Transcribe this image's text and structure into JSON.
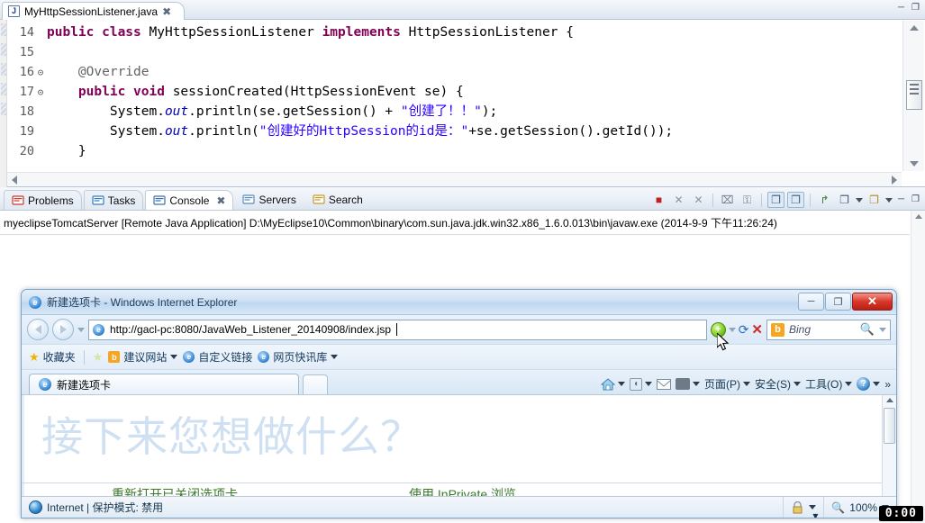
{
  "eclipse": {
    "editor_tab": {
      "label": "MyHttpSessionListener.java",
      "icon": "java-file-icon",
      "close": "✖"
    },
    "window_controls": {
      "minimize": "─",
      "maximize": "❐"
    },
    "code_lines": [
      {
        "num": "14",
        "fold": "",
        "tokens": [
          {
            "t": "kw",
            "s": "public "
          },
          {
            "t": "kw",
            "s": "class "
          },
          {
            "t": "plain",
            "s": "MyHttpSessionListener "
          },
          {
            "t": "kw",
            "s": "implements "
          },
          {
            "t": "plain",
            "s": "HttpSessionListener {"
          }
        ]
      },
      {
        "num": "15",
        "fold": "",
        "tokens": []
      },
      {
        "num": "16",
        "fold": "⊝",
        "tokens": [
          {
            "t": "plain",
            "s": "    "
          },
          {
            "t": "ann",
            "s": "@Override"
          }
        ]
      },
      {
        "num": "17",
        "fold": "⊝",
        "tokens": [
          {
            "t": "plain",
            "s": "    "
          },
          {
            "t": "kw",
            "s": "public "
          },
          {
            "t": "kw",
            "s": "void "
          },
          {
            "t": "plain",
            "s": "sessionCreated(HttpSessionEvent se) {"
          }
        ]
      },
      {
        "num": "18",
        "fold": "",
        "tokens": [
          {
            "t": "plain",
            "s": "        System."
          },
          {
            "t": "fld",
            "s": "out"
          },
          {
            "t": "plain",
            "s": ".println(se.getSession() + "
          },
          {
            "t": "str",
            "s": "\"创建了！！\""
          },
          {
            "t": "plain",
            "s": ");"
          }
        ]
      },
      {
        "num": "19",
        "fold": "",
        "tokens": [
          {
            "t": "plain",
            "s": "        System."
          },
          {
            "t": "fld",
            "s": "out"
          },
          {
            "t": "plain",
            "s": ".println("
          },
          {
            "t": "str",
            "s": "\"创建好的HttpSession的id是：\""
          },
          {
            "t": "plain",
            "s": "+se.getSession().getId());"
          }
        ]
      },
      {
        "num": "20",
        "fold": "",
        "tokens": [
          {
            "t": "plain",
            "s": "    }"
          }
        ]
      }
    ]
  },
  "console_view": {
    "tabs": [
      {
        "label": "Problems",
        "icon": "problems-icon",
        "active": false,
        "closable": false
      },
      {
        "label": "Tasks",
        "icon": "tasks-icon",
        "active": false,
        "closable": false
      },
      {
        "label": "Console",
        "icon": "console-icon",
        "active": true,
        "closable": true
      },
      {
        "label": "Servers",
        "icon": "servers-icon",
        "active": false,
        "closable": false
      },
      {
        "label": "Search",
        "icon": "search-icon",
        "active": false,
        "closable": false
      }
    ],
    "close_glyph": "✖",
    "toolbar": [
      {
        "name": "terminate-button",
        "glyph": "■",
        "selected": false,
        "color": "#c02020"
      },
      {
        "name": "remove-launch-button",
        "glyph": "✕",
        "selected": false,
        "color": "#8a96a3"
      },
      {
        "name": "remove-all-terminated-button",
        "glyph": "✕",
        "selected": false,
        "color": "#8a96a3"
      },
      {
        "name": "clear-console-button",
        "glyph": "⌧",
        "selected": false,
        "color": "#6f7c8a"
      },
      {
        "name": "scroll-lock-button",
        "glyph": "⚿",
        "selected": false,
        "color": "#6f7c8a"
      },
      {
        "name": "show-console-on-output-button",
        "glyph": "❐",
        "selected": true,
        "color": "#3f5a78"
      },
      {
        "name": "show-console-on-error-button",
        "glyph": "❐",
        "selected": true,
        "color": "#3f5a78"
      },
      {
        "name": "pin-console-button",
        "glyph": "↱",
        "selected": false,
        "color": "#4a7a3a"
      },
      {
        "name": "display-selected-console-button",
        "glyph": "❐",
        "selected": false,
        "color": "#3f5a78"
      },
      {
        "name": "open-console-button",
        "glyph": "❐",
        "selected": false,
        "color": "#b08a2a"
      }
    ],
    "view_minimize": "─",
    "view_maximize": "❐",
    "output_line": "myeclipseTomcatServer [Remote Java Application] D:\\MyEclipse10\\Common\\binary\\com.sun.java.jdk.win32.x86_1.6.0.013\\bin\\javaw.exe (2014-9-9 下午11:26:24)"
  },
  "ie_window": {
    "title": "新建选项卡 - Windows Internet Explorer",
    "title_icon": "ie-logo-icon",
    "controls": {
      "minimize": "─",
      "restore": "❐",
      "close": "✕"
    },
    "back_button": "back-arrow",
    "forward_button": "forward-arrow",
    "history_caret": "▾",
    "address": {
      "icon": "page-icon",
      "value": "http://gacl-pc:8080/JavaWeb_Listener_20140908/index.jsp",
      "placeholder": "http://"
    },
    "addr_tools": {
      "compat_glyph": "+",
      "compat_caret": "▾",
      "refresh_glyph": "⟳",
      "stop_glyph": "✕"
    },
    "search": {
      "engine": "Bing",
      "placeholder": "Bing",
      "value": "",
      "caret": "▾"
    },
    "favorites_bar": {
      "favorites_label": "收藏夹",
      "add_to_favorites": "add-favorite-icon",
      "items": [
        {
          "label": "建议网站",
          "icon": "suggested-sites-icon",
          "caret": "▾"
        },
        {
          "label": "自定义链接",
          "icon": "ie-icon",
          "caret": ""
        },
        {
          "label": "网页快讯库",
          "icon": "ie-icon",
          "caret": "▾"
        }
      ]
    },
    "tab": {
      "label": "新建选项卡",
      "icon": "ie-logo-icon"
    },
    "new_tab_button": "new-tab-button",
    "command_bar": {
      "home": {
        "label": "",
        "icon": "home-icon",
        "caret": "▾"
      },
      "feeds": {
        "label": "",
        "icon": "feeds-icon",
        "caret": "▾"
      },
      "mail": {
        "label": "",
        "icon": "mail-icon",
        "caret": ""
      },
      "print": {
        "label": "",
        "icon": "print-icon",
        "caret": "▾"
      },
      "page": {
        "label": "页面(P)",
        "caret": "▾"
      },
      "safety": {
        "label": "安全(S)",
        "caret": "▾"
      },
      "tools": {
        "label": "工具(O)",
        "caret": "▾"
      },
      "help": {
        "label": "",
        "icon": "help-icon",
        "caret": "▾"
      },
      "overflow": "»"
    },
    "page": {
      "heading": "接下来您想做什么？",
      "link_left": "重新打开已关闭选项卡",
      "link_right": "使用 InPrivate 浏览"
    },
    "status_bar": {
      "zone": "Internet | 保护模式: 禁用",
      "zone_icon": "internet-globe-icon",
      "privacy_icon": "privacy-lock-icon",
      "privacy_caret": "▾",
      "zoom_icon": "zoom-icon",
      "zoom_level": "100%",
      "zoom_caret": "▾"
    }
  },
  "overlay": {
    "timer": "0:00"
  }
}
